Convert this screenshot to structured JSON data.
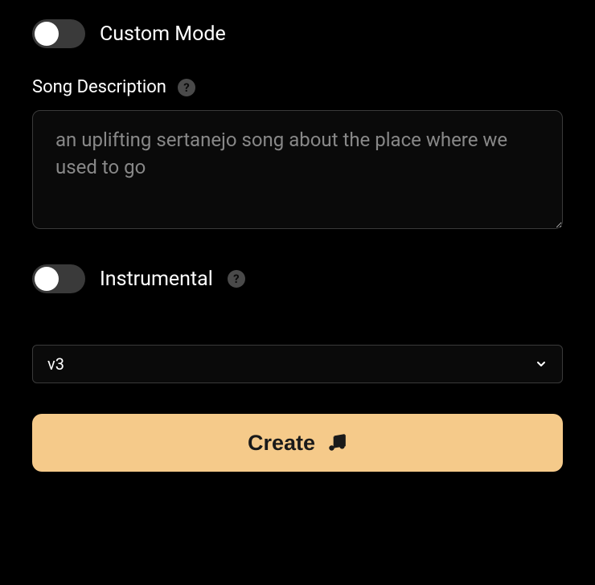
{
  "customMode": {
    "label": "Custom Mode",
    "enabled": false
  },
  "songDescription": {
    "label": "Song Description",
    "value": "an uplifting sertanejo song about the place where we used to go",
    "placeholder": ""
  },
  "instrumental": {
    "label": "Instrumental",
    "enabled": false
  },
  "versionSelect": {
    "selected": "v3"
  },
  "createButton": {
    "label": "Create"
  }
}
